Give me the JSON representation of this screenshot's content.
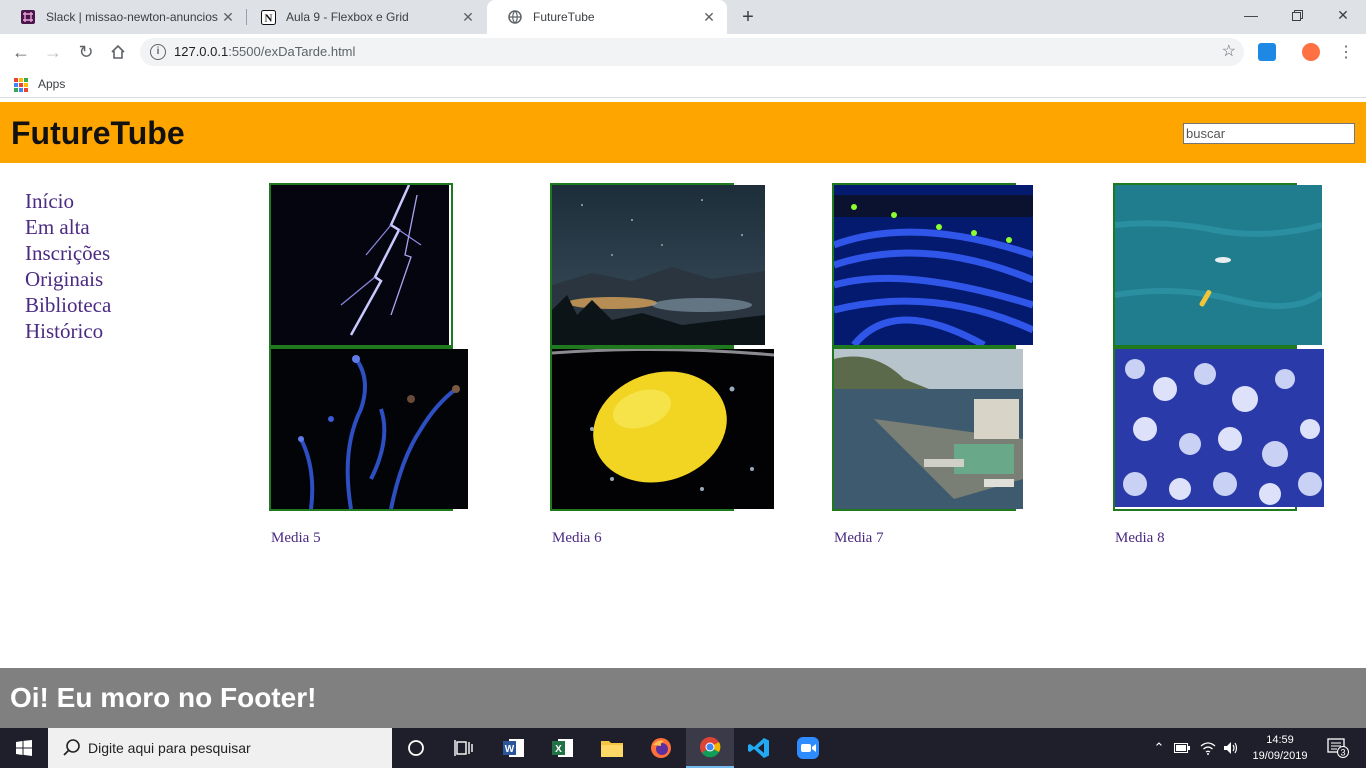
{
  "browser": {
    "tabs": [
      {
        "label": "Slack | missao-newton-anuncios |",
        "icon": "slack-icon"
      },
      {
        "label": "Aula 9 - Flexbox e Grid",
        "icon": "notion-icon"
      },
      {
        "label": "FutureTube",
        "icon": "globe-icon"
      }
    ],
    "active_tab": 2,
    "url_host": "127.0.0.1",
    "url_rest": ":5500/exDaTarde.html",
    "bookmarks_apps_label": "Apps"
  },
  "site": {
    "title": "FutureTube",
    "search_placeholder": "buscar",
    "nav": [
      "Início",
      "Em alta",
      "Inscrições",
      "Originais",
      "Biblioteca",
      "Histórico"
    ],
    "media_captions": [
      "Media 5",
      "Media 6",
      "Media 7",
      "Media 8"
    ],
    "thumbnails": [
      "lightning",
      "night-mountains",
      "network-cables",
      "ocean-boats",
      "water-splash",
      "lemon-underwater",
      "harbor-village",
      "snowy-forest"
    ],
    "footer_text": "Oi! Eu moro no Footer!"
  },
  "taskbar": {
    "search_placeholder": "Digite aqui para pesquisar",
    "time": "14:59",
    "date": "19/09/2019",
    "notifications": "3"
  }
}
